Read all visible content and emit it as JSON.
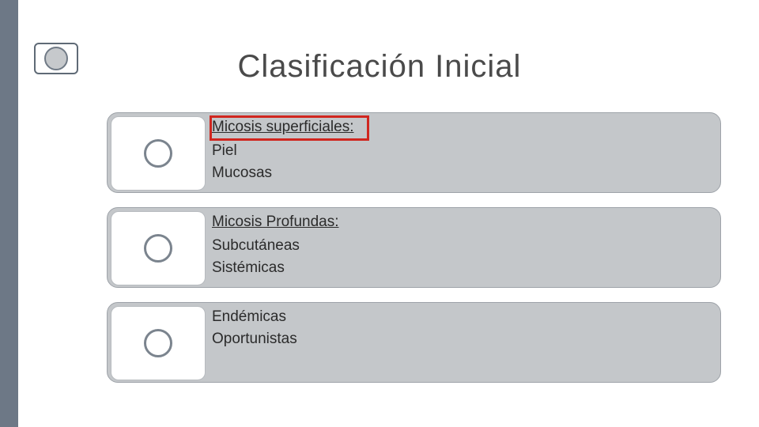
{
  "title": "Clasificación Inicial",
  "cards": [
    {
      "heading": "Micosis superficiales:",
      "items": [
        "Piel",
        "Mucosas"
      ],
      "highlight_heading": true
    },
    {
      "heading": "Micosis Profundas:",
      "items": [
        "Subcutáneas",
        "Sistémicas"
      ],
      "highlight_heading": false
    },
    {
      "heading": "",
      "items": [
        "Endémicas",
        "Oportunistas"
      ],
      "highlight_heading": false
    }
  ]
}
